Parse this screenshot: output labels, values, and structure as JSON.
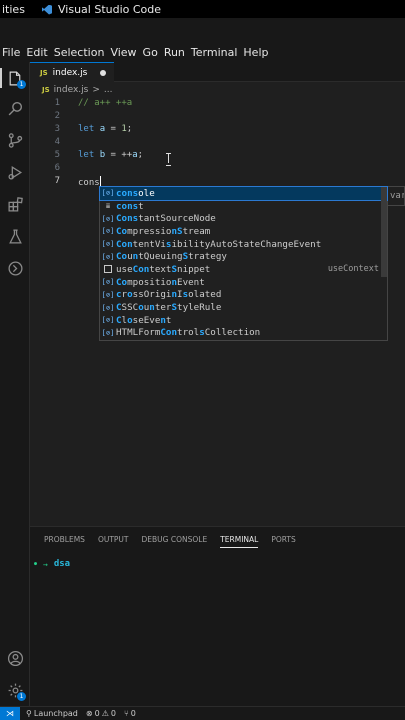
{
  "system_bar": {
    "left_text": "ities",
    "app_title": "Visual Studio Code"
  },
  "menu": [
    "File",
    "Edit",
    "Selection",
    "View",
    "Go",
    "Run",
    "Terminal",
    "Help"
  ],
  "activity_bar": {
    "items": [
      "explorer-icon",
      "search-icon",
      "source-control-icon",
      "run-debug-icon",
      "extensions-icon",
      "testing-icon",
      "remote-explorer-icon"
    ],
    "explorer_badge": "1",
    "bottom": [
      "account-icon",
      "settings-icon"
    ],
    "settings_badge": "1"
  },
  "tab": {
    "icon_text": "JS",
    "label": "index.js"
  },
  "breadcrumb": {
    "icon_text": "JS",
    "file": "index.js",
    "separator": ">",
    "rest": "..."
  },
  "editor": {
    "lines": [
      {
        "num": "1",
        "text": "// a++ ++a"
      },
      {
        "num": "2",
        "text": ""
      },
      {
        "num": "3",
        "text": "let a = 1;"
      },
      {
        "num": "4",
        "text": ""
      },
      {
        "num": "5",
        "text": "let b = ++a;"
      },
      {
        "num": "6",
        "text": ""
      },
      {
        "num": "7",
        "text": "cons"
      }
    ]
  },
  "suggestions": [
    {
      "label": "console",
      "match": "cons",
      "rest": "ole",
      "kind": "variable"
    },
    {
      "label": "const",
      "match": "cons",
      "rest": "t",
      "kind": "keyword"
    },
    {
      "label": "ConstantSourceNode",
      "kind": "variable"
    },
    {
      "label": "CompressionStream",
      "kind": "variable"
    },
    {
      "label": "ContentVisibilityAutoStateChangeEvent",
      "kind": "variable"
    },
    {
      "label": "CountQueuingStrategy",
      "kind": "variable"
    },
    {
      "label": "useContextSnippet",
      "detail": "useContext",
      "kind": "snippet"
    },
    {
      "label": "CompositionEvent",
      "kind": "variable"
    },
    {
      "label": "crossOriginIsolated",
      "kind": "variable"
    },
    {
      "label": "CSSCounterStyleRule",
      "kind": "variable"
    },
    {
      "label": "CloseEvent",
      "kind": "variable"
    },
    {
      "label": "HTMLFormControlsCollection",
      "kind": "variable"
    }
  ],
  "doc_peek": "var",
  "panel": {
    "tabs": [
      "PROBLEMS",
      "OUTPUT",
      "DEBUG CONSOLE",
      "TERMINAL",
      "PORTS"
    ],
    "active_tab": "TERMINAL",
    "terminal": {
      "arrow": "→",
      "cwd": "dsa"
    }
  },
  "status_bar": {
    "launchpad": "Launchpad",
    "errors": "0",
    "warnings": "0",
    "ports": "0"
  },
  "colors": {
    "accent": "#0078d4",
    "background": "#1f1f1f",
    "sidebar": "#181818"
  }
}
